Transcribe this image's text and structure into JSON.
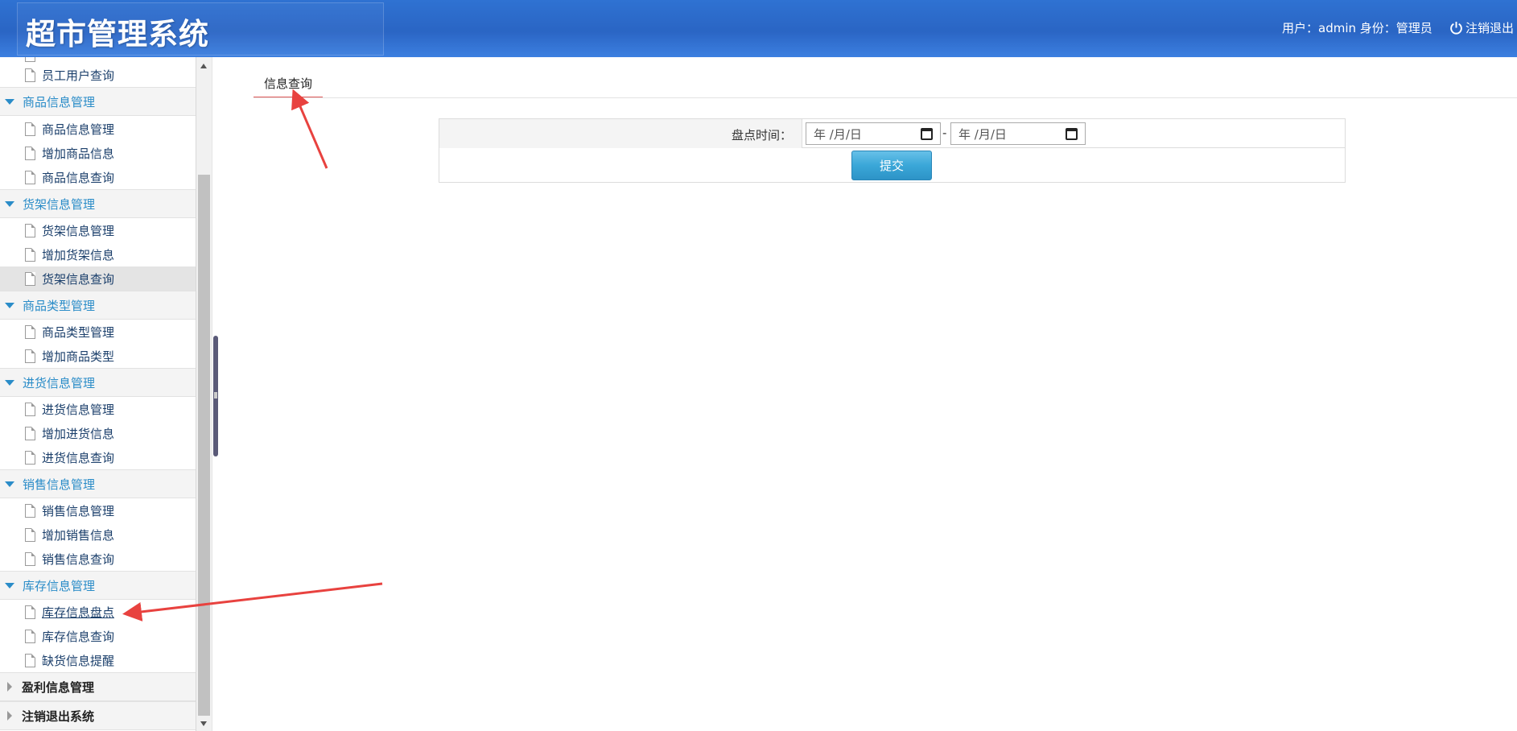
{
  "header": {
    "title": "超市管理系统",
    "user_info": "用户：admin 身份：管理员",
    "logout_label": "注销退出"
  },
  "sidebar": {
    "partial_item": "员工用户查询",
    "groups": [
      {
        "label": "商品信息管理",
        "expanded": true,
        "items": [
          "商品信息管理",
          "增加商品信息",
          "商品信息查询"
        ]
      },
      {
        "label": "货架信息管理",
        "expanded": true,
        "items": [
          "货架信息管理",
          "增加货架信息",
          "货架信息查询"
        ]
      },
      {
        "label": "商品类型管理",
        "expanded": true,
        "items": [
          "商品类型管理",
          "增加商品类型"
        ]
      },
      {
        "label": "进货信息管理",
        "expanded": true,
        "items": [
          "进货信息管理",
          "增加进货信息",
          "进货信息查询"
        ]
      },
      {
        "label": "销售信息管理",
        "expanded": true,
        "items": [
          "销售信息管理",
          "增加销售信息",
          "销售信息查询"
        ]
      },
      {
        "label": "库存信息管理",
        "expanded": true,
        "items": [
          "库存信息盘点",
          "库存信息查询",
          "缺货信息提醒"
        ]
      },
      {
        "label": "盈利信息管理",
        "expanded": false,
        "items": []
      },
      {
        "label": "注销退出系统",
        "expanded": false,
        "items": []
      }
    ],
    "active_item": "货架信息查询",
    "link_item": "库存信息盘点"
  },
  "main": {
    "tab_label": "信息查询",
    "form": {
      "label": "盘点时间：",
      "start_placeholder": "年 /月/日",
      "separator": "-",
      "end_placeholder": "年 /月/日",
      "submit_label": "提交"
    }
  },
  "colors": {
    "header_bg": "#2a65c4",
    "accent_blue": "#2a8cc8",
    "tab_underline": "#e05a5a",
    "annotation_arrow": "#e8423f"
  }
}
